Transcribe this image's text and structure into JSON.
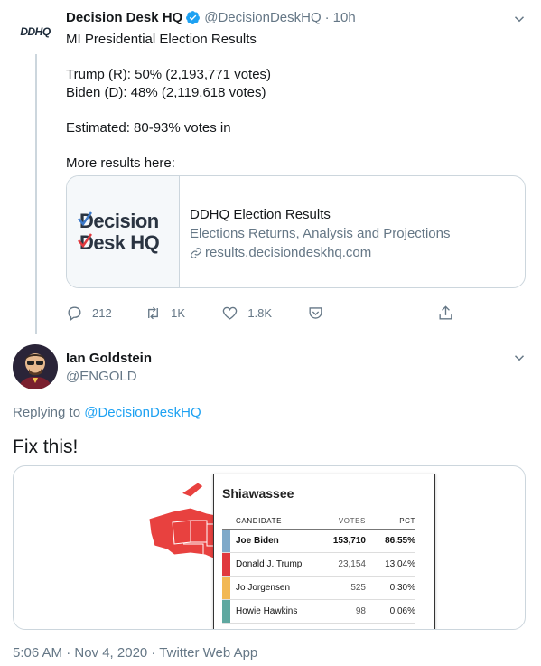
{
  "tweet1": {
    "avatar_text": "DDHQ",
    "name": "Decision Desk HQ",
    "handle": "@DecisionDeskHQ",
    "separator": "·",
    "time": "10h",
    "lines": [
      "MI Presidential Election Results",
      "",
      "Trump (R): 50% (2,193,771 votes)",
      "Biden (D): 48% (2,119,618 votes)",
      "",
      "Estimated: 80-93% votes in",
      "",
      "More results here:"
    ],
    "card": {
      "logo_line1": "Decision",
      "logo_line2": "Desk HQ",
      "title": "DDHQ Election Results",
      "description": "Elections Returns, Analysis and Projections",
      "domain": "results.decisiondeskhq.com"
    },
    "actions": {
      "replies": "212",
      "retweets": "1K",
      "likes": "1.8K"
    }
  },
  "tweet2": {
    "name": "Ian Goldstein",
    "handle": "@ENGOLD",
    "replying_prefix": "Replying to",
    "replying_to": "@DecisionDeskHQ",
    "text": "Fix this!",
    "media": {
      "county": "Shiawassee",
      "headers": {
        "candidate": "CANDIDATE",
        "votes": "VOTES",
        "pct": "PCT"
      },
      "rows": [
        {
          "name": "Joe Biden",
          "votes": "153,710",
          "pct": "86.55%",
          "color": "#7fa9c9",
          "winner": true
        },
        {
          "name": "Donald J. Trump",
          "votes": "23,154",
          "pct": "13.04%",
          "color": "#e0393e",
          "winner": false
        },
        {
          "name": "Jo Jorgensen",
          "votes": "525",
          "pct": "0.30%",
          "color": "#f2b854",
          "winner": false
        },
        {
          "name": "Howie Hawkins",
          "votes": "98",
          "pct": "0.06%",
          "color": "#5fa8a0",
          "winner": false
        }
      ]
    },
    "footer": "5:06 AM · Nov 4, 2020 · Twitter Web App"
  },
  "colors": {
    "accent": "#1da1f2",
    "muted": "#657786",
    "border": "#ccd6dd",
    "map_red": "#e8413f"
  }
}
